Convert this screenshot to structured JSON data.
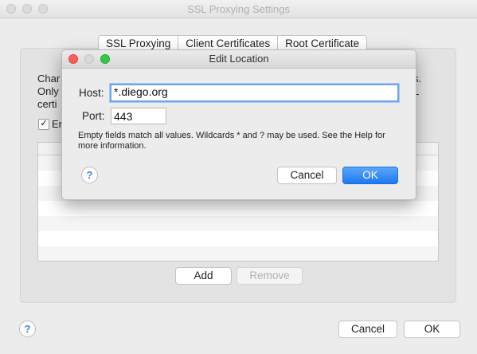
{
  "window": {
    "title": "SSL Proxying Settings"
  },
  "tabs": [
    {
      "label": "SSL Proxying"
    },
    {
      "label": "Client Certificates"
    },
    {
      "label": "Root Certificate"
    }
  ],
  "panel": {
    "desc_left": [
      "Char",
      "Only",
      "certi"
    ],
    "desc_right": [
      "s.",
      "L"
    ],
    "enable_checked": true,
    "enable_label": "Er",
    "add_label": "Add",
    "remove_label": "Remove"
  },
  "footer": {
    "cancel_label": "Cancel",
    "ok_label": "OK",
    "help_glyph": "?"
  },
  "dialog": {
    "title": "Edit Location",
    "host_label": "Host:",
    "host_value": "*.diego.org",
    "port_label": "Port:",
    "port_value": "443",
    "note": "Empty fields match all values. Wildcards * and ? may be used. See the Help for more information.",
    "cancel_label": "Cancel",
    "ok_label": "OK",
    "help_glyph": "?"
  },
  "colors": {
    "accent": "#1d78f0",
    "traffic_red": "#fc5f57",
    "traffic_yellow": "#d8d8d8",
    "traffic_green": "#34c84a"
  }
}
